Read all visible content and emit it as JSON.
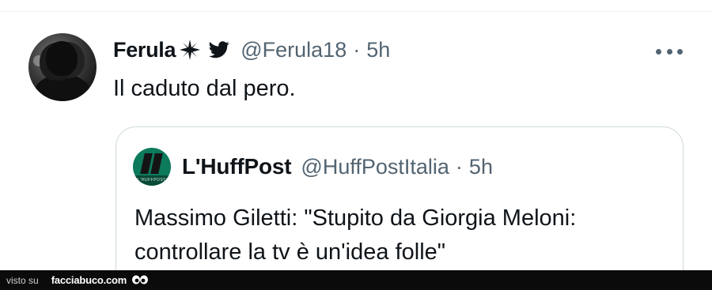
{
  "tweet": {
    "display_name": "Ferula",
    "icons": [
      "sparkle-star-icon",
      "twitter-bird-icon",
      "more-dots-icon"
    ],
    "handle": "@Ferula18",
    "separator": "·",
    "time": "5h",
    "text": "Il caduto dal pero."
  },
  "quote": {
    "display_name": "L'HuffPost",
    "logo_text": "L'HUFFPOST",
    "handle": "@HuffPostItalia",
    "separator": "·",
    "time": "5h",
    "text": "Massimo Giletti: \"Stupito da Giorgia Meloni: controllare la tv è un'idea folle\""
  },
  "footer": {
    "prefix": "visto su",
    "brand": "facciabuco.com"
  },
  "colors": {
    "text_primary": "#0f1419",
    "text_secondary": "#536471",
    "card_border": "#cfd9de",
    "huffpost_green": "#0d7a5c",
    "footer_bg": "#0b0b0b"
  }
}
